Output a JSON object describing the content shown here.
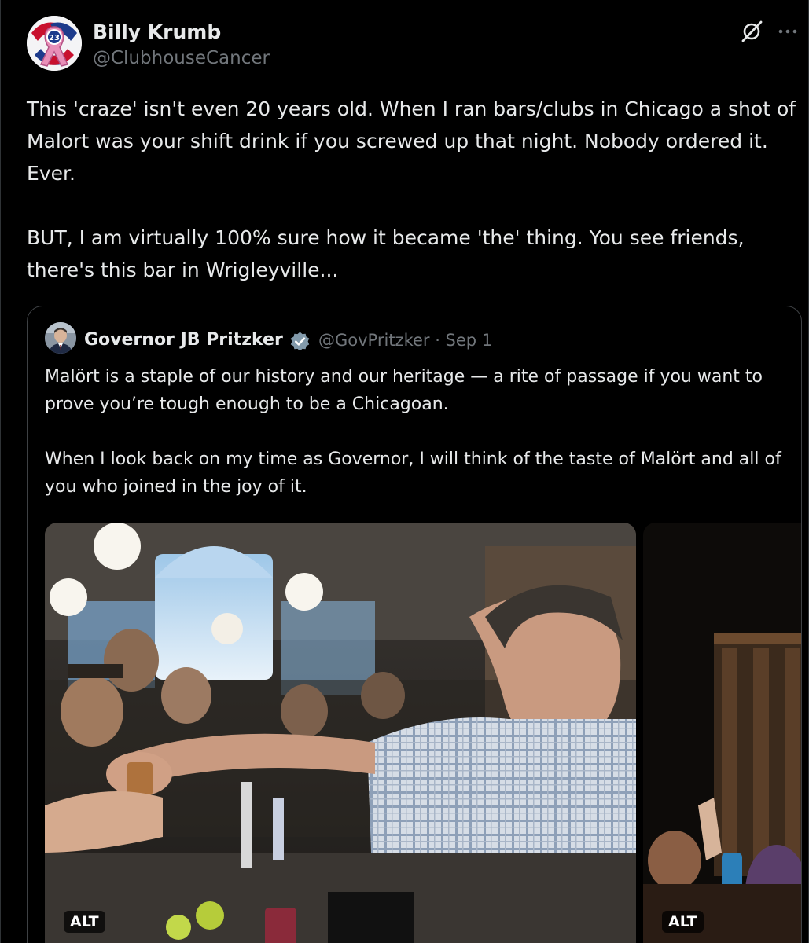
{
  "author": {
    "name": "Billy Krumb",
    "handle": "@ClubhouseCancer"
  },
  "post": {
    "text": "This 'craze' isn't even 20 years old. When I ran bars/clubs in Chicago a shot of Malort was your shift drink if you screwed up that night. Nobody ordered it. Ever.\n\nBUT, I am virtually 100% sure how it became 'the' thing. You see friends, there's this bar in Wrigleyville..."
  },
  "quoted": {
    "name": "Governor JB Pritzker",
    "handle_date": "@GovPritzker · Sep 1",
    "text": "Malört is a staple of our history and our heritage — a rite of passage if you want to prove you’re tough enough to be a Chicagoan.\n\nWhen I look back on my time as Governor, I will think of the taste of Malört and all of you who joined in the joy of it.",
    "media": [
      {
        "alt_label": "ALT"
      },
      {
        "alt_label": "ALT"
      }
    ]
  },
  "icons": {
    "grok": "grok-icon",
    "more": "more-icon",
    "verified": "verified-badge-icon"
  },
  "colors": {
    "background": "#000000",
    "text": "#e7e9ea",
    "secondary": "#71767b",
    "border": "#3e4144",
    "verified_badge": "#829aab"
  }
}
